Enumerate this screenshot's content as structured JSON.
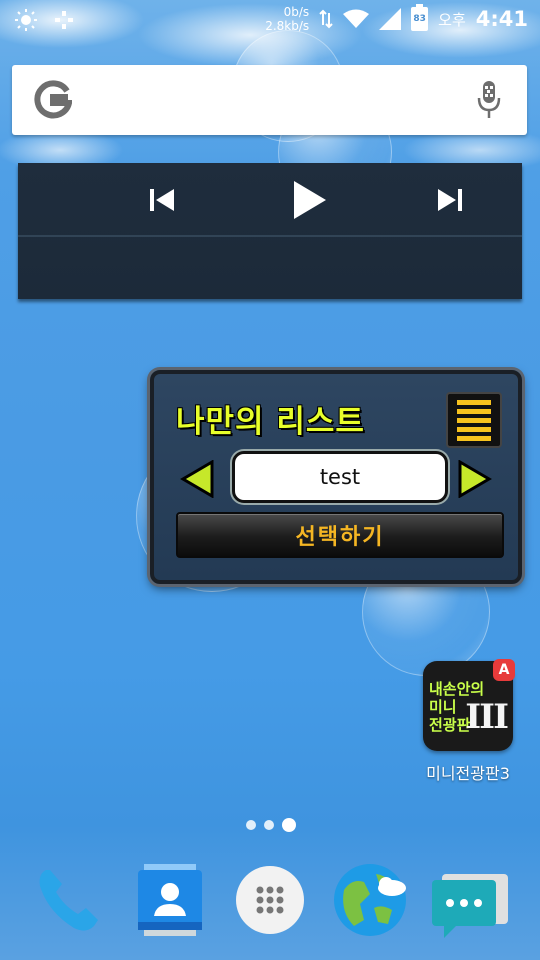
{
  "status_bar": {
    "net_up": "0b/s",
    "net_down": "2.8kb/s",
    "battery": "83",
    "ampm": "오후",
    "time": "4:41"
  },
  "my_list_widget": {
    "title": "나만의 리스트",
    "current_item": "test",
    "select_label": "선택하기"
  },
  "app": {
    "icon_line1": "내손안의",
    "icon_line2": "미니",
    "icon_line3": "전광판",
    "icon_roman": "III",
    "icon_badge": "A",
    "label": "미니전광판3"
  },
  "colors": {
    "accent_yellow": "#e8ff2a",
    "select_text": "#f5b623",
    "widget_bg": "#1f2d3d"
  }
}
